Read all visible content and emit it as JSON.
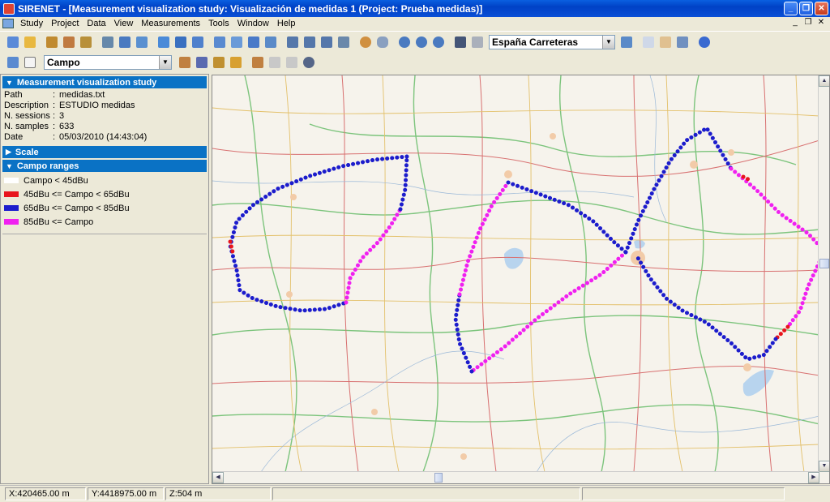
{
  "window": {
    "title": "SIRENET - [Measurement visualization study: Visualización de medidas 1 (Project: Prueba medidas)]"
  },
  "menu": [
    "Study",
    "Project",
    "Data",
    "View",
    "Measurements",
    "Tools",
    "Window",
    "Help"
  ],
  "toolbar": {
    "map_select": "España Carreteras",
    "layer_select": "Campo"
  },
  "study": {
    "header": "Measurement visualization study",
    "rows": [
      {
        "key": "Path",
        "value": "medidas.txt"
      },
      {
        "key": "Description",
        "value": "ESTUDIO medidas"
      },
      {
        "key": "N. sessions",
        "value": "3"
      },
      {
        "key": "N. samples",
        "value": "633"
      },
      {
        "key": "Date",
        "value": "05/03/2010 (14:43:04)"
      }
    ]
  },
  "scale": {
    "header": "Scale"
  },
  "ranges": {
    "header": "Campo ranges",
    "items": [
      {
        "label": "Campo < 45dBu",
        "color": "#ffffff"
      },
      {
        "label": "45dBu <= Campo < 65dBu",
        "color": "#e8141c"
      },
      {
        "label": "65dBu <= Campo < 85dBu",
        "color": "#1c1ccc"
      },
      {
        "label": "85dBu <= Campo",
        "color": "#f020f0"
      }
    ]
  },
  "status": {
    "x": "X:420465.00 m",
    "y": "Y:4418975.00 m",
    "z": "Z:504 m"
  }
}
